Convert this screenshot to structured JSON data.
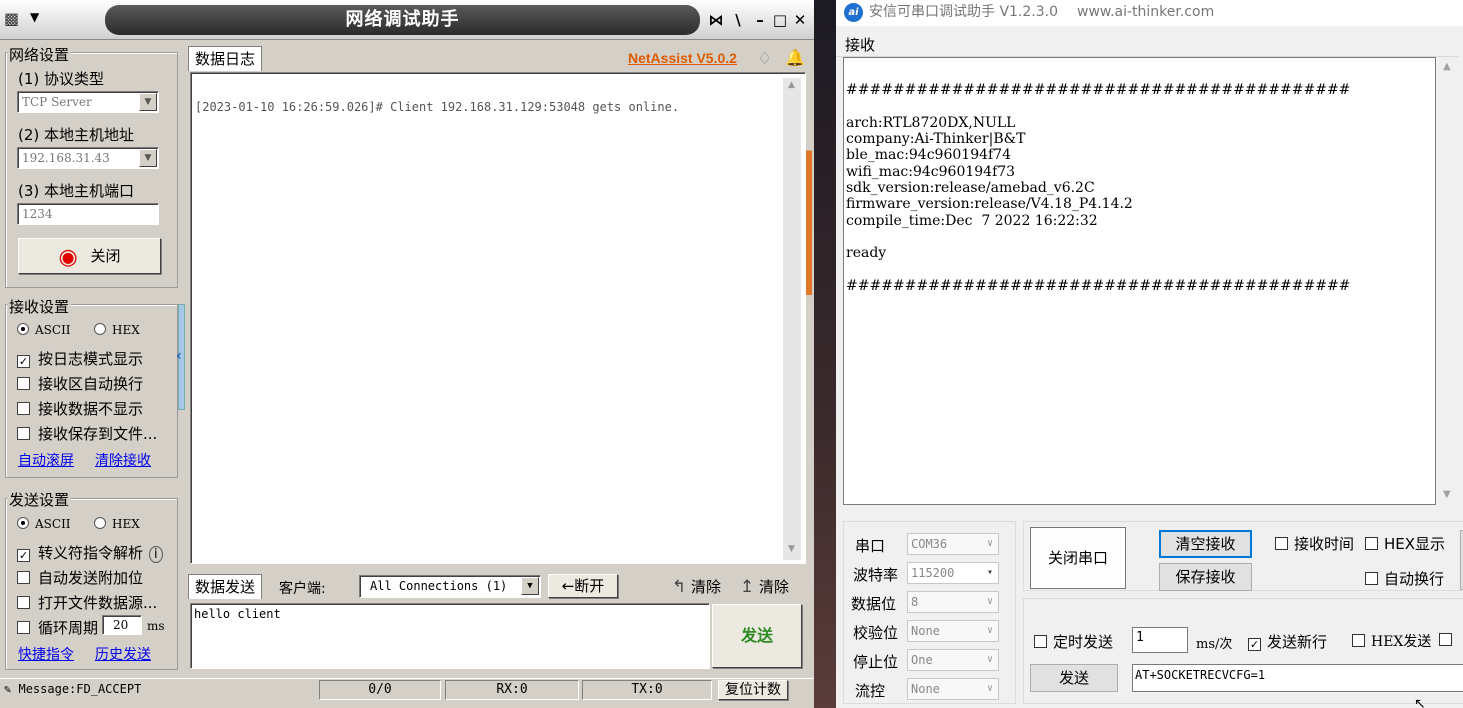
{
  "netassist": {
    "title": "网络调试助手",
    "window_buttons": [
      "⋈",
      "\\",
      "–",
      "□",
      "✕"
    ],
    "network_settings": {
      "title": "网络设置",
      "protocol_label": "(1) 协议类型",
      "protocol_value": "TCP Server",
      "host_addr_label": "(2) 本地主机地址",
      "host_addr_value": "192.168.31.43",
      "host_port_label": "(3) 本地主机端口",
      "host_port_value": "1234",
      "toggle_button": "关闭"
    },
    "receive_settings": {
      "title": "接收设置",
      "ascii": "ASCII",
      "hex": "HEX",
      "log_mode": "按日志模式显示",
      "auto_wrap": "接收区自动换行",
      "hide_data": "接收数据不显示",
      "save_file": "接收保存到文件...",
      "auto_scroll": "自动滚屏",
      "clear": "清除接收"
    },
    "send_settings": {
      "title": "发送设置",
      "ascii": "ASCII",
      "hex": "HEX",
      "escape": "转义符指令解析",
      "append": "自动发送附加位",
      "open_file": "打开文件数据源...",
      "loop": "循环周期",
      "loop_value": "20",
      "loop_unit": "ms",
      "shortcuts": "快捷指令",
      "history": "历史发送"
    },
    "log": {
      "tab": "数据日志",
      "brand": "NetAssist V5.0.2",
      "line": "[2023-01-10 16:26:59.026]# Client 192.168.31.129:53048 gets online."
    },
    "send_bar": {
      "tab": "数据发送",
      "client_label": "客户端:",
      "connection": "All Connections (1)",
      "disconnect": "断开",
      "clear1": "清除",
      "clear2": "清除"
    },
    "send_text": "hello client",
    "send_button": "发送",
    "status": {
      "message": "Message:FD_ACCEPT",
      "counts": "0/0",
      "rx": "RX:0",
      "tx": "TX:0",
      "reset": "复位计数"
    },
    "colors": {
      "brand": "#e05a00",
      "send": "#2e8b22",
      "link": "#0000ee",
      "led": "#e00000"
    }
  },
  "aithinker": {
    "title": "安信可串口调试助手 V1.2.3.0",
    "url": "www.ai-thinker.com",
    "receive_label": "接收",
    "receive_lines": [
      "",
      "###########################################",
      "",
      "arch:RTL8720DX,NULL",
      "company:Ai-Thinker|B&T",
      "ble_mac:94c960194f74",
      "wifi_mac:94c960194f73",
      "sdk_version:release/amebad_v6.2C",
      "firmware_version:release/V4.18_P4.14.2",
      "compile_time:Dec  7 2022 16:22:32",
      "",
      "ready",
      "",
      "###########################################"
    ],
    "port": {
      "label": "串口",
      "value": "COM36"
    },
    "baud": {
      "label": "波特率",
      "value": "115200"
    },
    "databits": {
      "label": "数据位",
      "value": "8"
    },
    "parity": {
      "label": "校验位",
      "value": "None"
    },
    "stopbits": {
      "label": "停止位",
      "value": "One"
    },
    "flow": {
      "label": "流控",
      "value": "None"
    },
    "close_port": "关闭串口",
    "clear_recv": "清空接收",
    "save_recv": "保存接收",
    "recv_time": "接收时间",
    "hex_display": "HEX显示",
    "auto_wrap": "自动换行",
    "timed_send": "定时发送",
    "interval_value": "1",
    "interval_unit": "ms/次",
    "send_newline": "发送新行",
    "hex_send": "HEX发送",
    "send": "发送",
    "send_input": "AT+SOCKETRECVCFG=1"
  }
}
